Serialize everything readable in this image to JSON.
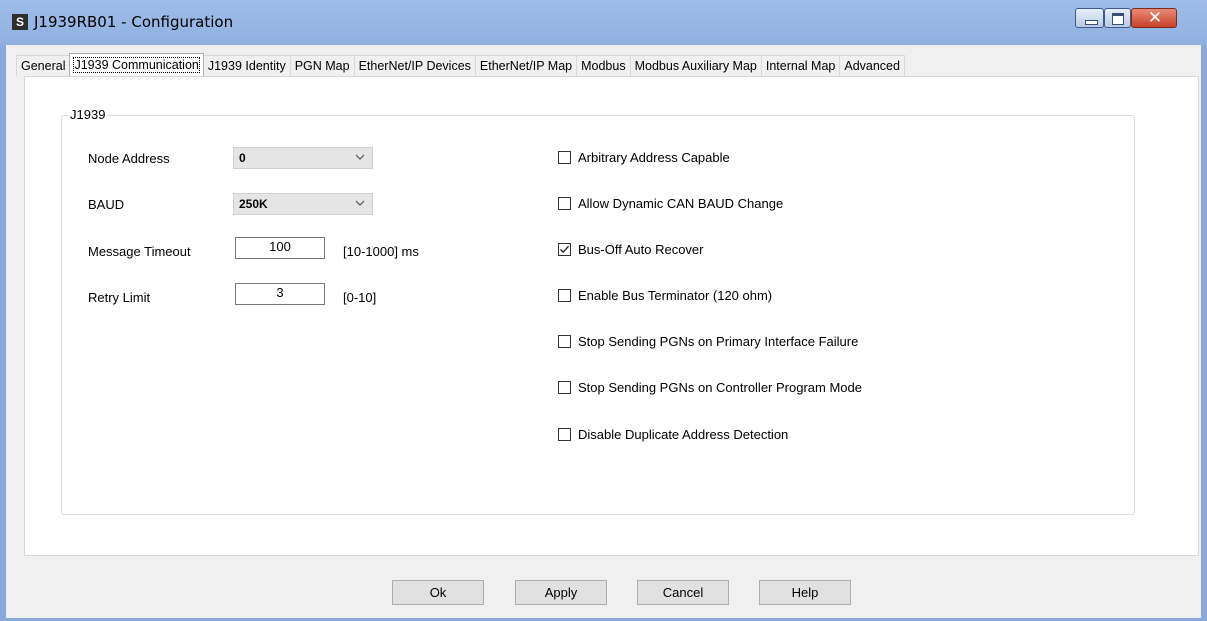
{
  "window": {
    "title": "J1939RB01 - Configuration",
    "app_icon_letter": "S",
    "close_glyph": "✕"
  },
  "tabs": [
    {
      "label": "General",
      "active": false
    },
    {
      "label": "J1939 Communication",
      "active": true
    },
    {
      "label": "J1939 Identity",
      "active": false
    },
    {
      "label": "PGN Map",
      "active": false
    },
    {
      "label": "EtherNet/IP Devices",
      "active": false
    },
    {
      "label": "EtherNet/IP Map",
      "active": false
    },
    {
      "label": "Modbus",
      "active": false
    },
    {
      "label": "Modbus Auxiliary Map",
      "active": false
    },
    {
      "label": "Internal Map",
      "active": false
    },
    {
      "label": "Advanced",
      "active": false
    }
  ],
  "group": {
    "legend": "J1939",
    "node_address_label": "Node Address",
    "node_address_value": "0",
    "baud_label": "BAUD",
    "baud_value": "250K",
    "message_timeout_label": "Message Timeout",
    "message_timeout_value": "100",
    "message_timeout_range": "[10-1000] ms",
    "retry_limit_label": "Retry Limit",
    "retry_limit_value": "3",
    "retry_limit_range": "[0-10]"
  },
  "checkboxes": [
    {
      "label": "Arbitrary Address Capable",
      "checked": false
    },
    {
      "label": "Allow Dynamic CAN BAUD Change",
      "checked": false
    },
    {
      "label": "Bus-Off Auto Recover",
      "checked": true
    },
    {
      "label": "Enable Bus Terminator (120 ohm)",
      "checked": false
    },
    {
      "label": "Stop Sending PGNs on Primary Interface Failure",
      "checked": false
    },
    {
      "label": "Stop Sending PGNs on Controller Program Mode",
      "checked": false
    },
    {
      "label": "Disable Duplicate Address Detection",
      "checked": false
    }
  ],
  "buttons": {
    "ok": "Ok",
    "apply": "Apply",
    "cancel": "Cancel",
    "help": "Help"
  },
  "colors": {
    "titlebar": "#9fbde8",
    "close_button": "#c8412a",
    "window_bg": "#f0f0f0"
  }
}
